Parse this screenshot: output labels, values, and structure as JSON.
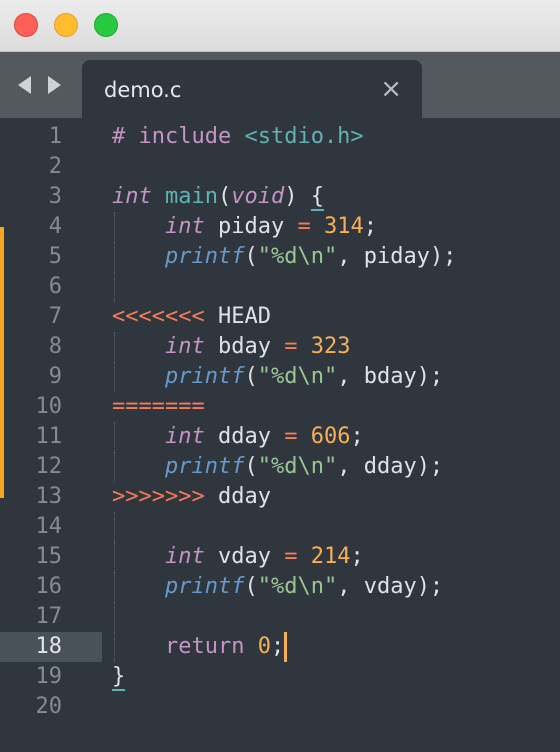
{
  "window": {
    "traffic_lights": [
      "close",
      "minimize",
      "zoom"
    ],
    "colors": {
      "red": "#fe5f57",
      "yellow": "#febc2e",
      "green": "#28c840"
    }
  },
  "tab": {
    "title": "demo.c",
    "close_glyph": "×"
  },
  "editor": {
    "active_line": 18,
    "git_modified_lines": "5-13",
    "lines": [
      {
        "n": "1",
        "t": "# include <stdio.h>"
      },
      {
        "n": "2",
        "t": ""
      },
      {
        "n": "3",
        "t": "int main(void) {"
      },
      {
        "n": "4",
        "t": "    int piday = 314;"
      },
      {
        "n": "5",
        "t": "    printf(\"%d\\n\", piday);"
      },
      {
        "n": "6",
        "t": ""
      },
      {
        "n": "7",
        "t": "<<<<<<< HEAD"
      },
      {
        "n": "8",
        "t": "    int bday = 323"
      },
      {
        "n": "9",
        "t": "    printf(\"%d\\n\", bday);"
      },
      {
        "n": "10",
        "t": "======="
      },
      {
        "n": "11",
        "t": "    int dday = 606;"
      },
      {
        "n": "12",
        "t": "    printf(\"%d\\n\", dday);"
      },
      {
        "n": "13",
        "t": ">>>>>>> dday"
      },
      {
        "n": "14",
        "t": ""
      },
      {
        "n": "15",
        "t": "    int vday = 214;"
      },
      {
        "n": "16",
        "t": "    printf(\"%d\\n\", vday);"
      },
      {
        "n": "17",
        "t": ""
      },
      {
        "n": "18",
        "t": "    return 0;"
      },
      {
        "n": "19",
        "t": "}"
      },
      {
        "n": "20",
        "t": ""
      }
    ]
  }
}
